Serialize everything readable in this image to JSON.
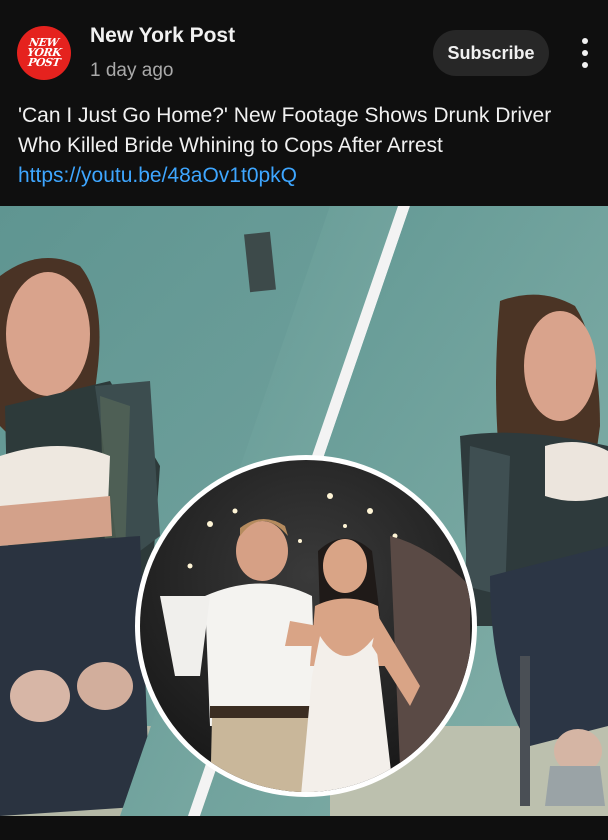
{
  "post": {
    "channel_name": "New York Post",
    "avatar_logo_lines": [
      "NEW",
      "YORK",
      "POST"
    ],
    "time_ago": "1 day ago",
    "subscribe_label": "Subscribe",
    "menu_icon": "more-vertical-icon",
    "title": "'Can I Just Go Home?' New Footage Shows Drunk Driver Who Killed Bride Whining to Cops After Arrest",
    "link": "https://youtu.be/48aOv1t0pkQ"
  },
  "colors": {
    "background": "#0f0f0f",
    "text_primary": "#f1f1f1",
    "text_secondary": "#aaaaaa",
    "link": "#3ea6ff",
    "subscribe_bg": "#272727",
    "avatar_brand": "#e5221e"
  }
}
